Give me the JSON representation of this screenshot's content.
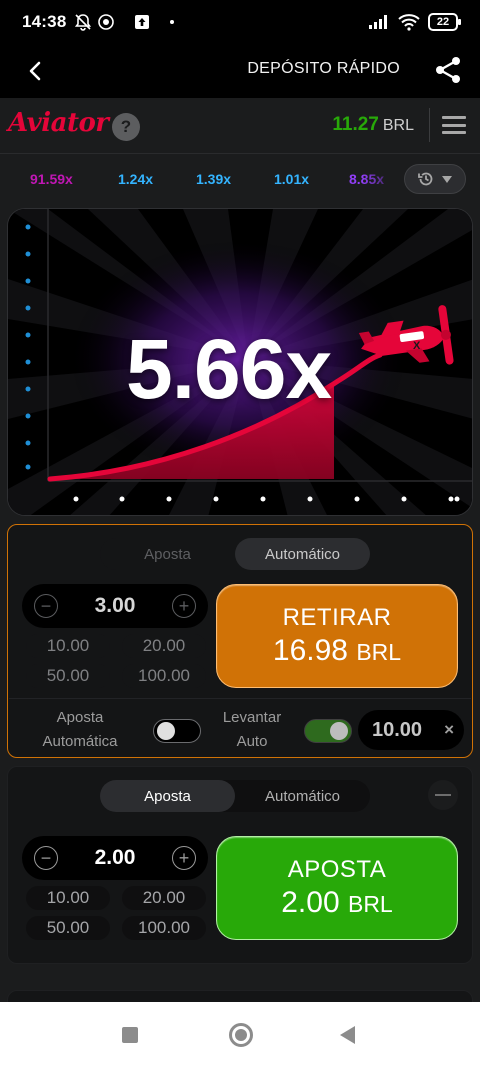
{
  "status_bar": {
    "time": "14:38",
    "battery": "22"
  },
  "top_nav": {
    "deposit_label": "DEPÓSITO RÁPIDO"
  },
  "game_header": {
    "logo": "Aviator",
    "help": "?",
    "balance_amount": "11.27",
    "balance_currency": "BRL"
  },
  "history": {
    "multipliers": [
      {
        "value": "91.59x",
        "color": "#c017b4"
      },
      {
        "value": "1.24x",
        "color": "#34b4ff"
      },
      {
        "value": "1.39x",
        "color": "#34b4ff"
      },
      {
        "value": "1.01x",
        "color": "#34b4ff"
      },
      {
        "value": "8.85x",
        "color": "#913ef8"
      }
    ]
  },
  "game": {
    "current_multiplier": "5.66x",
    "plane_marks": "X"
  },
  "bet_panel_1": {
    "tabs": [
      "Aposta",
      "Automático"
    ],
    "selected_tab": "Automático",
    "amount": "3.00",
    "quick_amounts": [
      "10.00",
      "20.00",
      "50.00",
      "100.00"
    ],
    "button_line1": "RETIRAR",
    "button_amount": "16.98",
    "button_currency": "BRL",
    "auto_bet_label_1": "Aposta",
    "auto_bet_label_2": "Automática",
    "auto_bet_on": false,
    "auto_cashout_label_1": "Levantar",
    "auto_cashout_label_2": "Auto",
    "auto_cashout_on": true,
    "auto_cashout_value": "10.00",
    "clear_label": "×"
  },
  "bet_panel_2": {
    "tabs": [
      "Aposta",
      "Automático"
    ],
    "selected_tab": "Aposta",
    "amount": "2.00",
    "quick_amounts": [
      "10.00",
      "20.00",
      "50.00",
      "100.00"
    ],
    "button_line1": "APOSTA",
    "button_amount": "2.00",
    "button_currency": "BRL"
  },
  "colors": {
    "accent_red": "#e50539",
    "balance_green": "#28a909",
    "cashout_orange": "#d07206",
    "bet_green": "#28a909"
  }
}
